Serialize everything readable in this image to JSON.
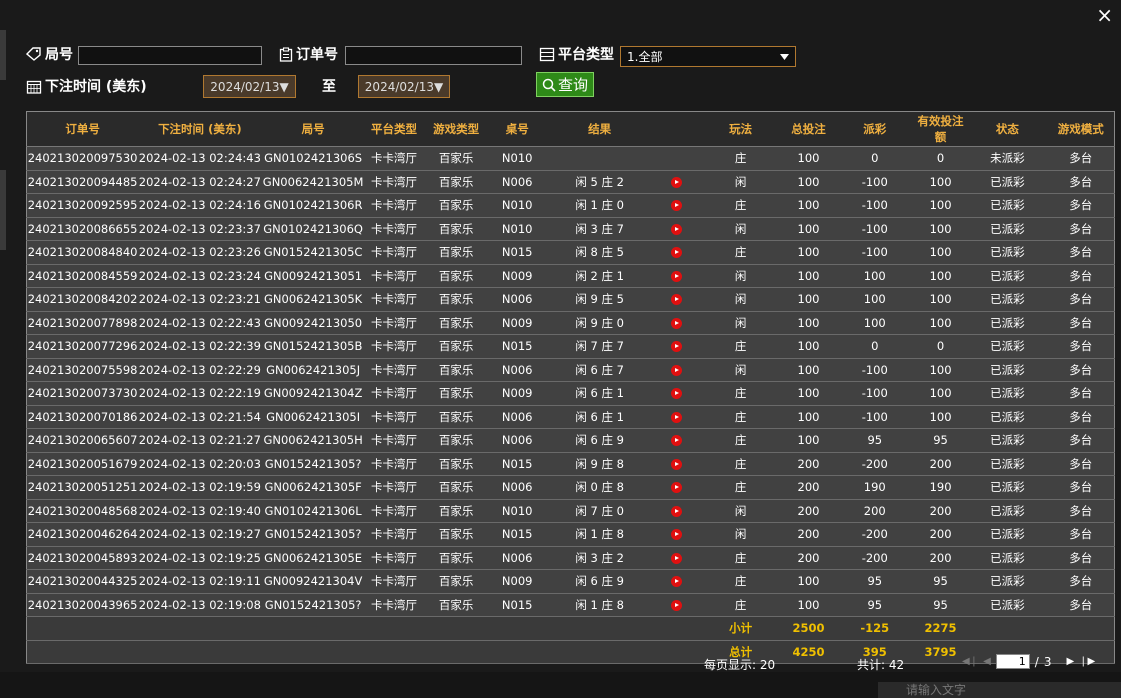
{
  "close_glyph": "×",
  "filters": {
    "round_label": "局号",
    "round_value": "",
    "order_label": "订单号",
    "order_value": "",
    "platform_label": "平台类型",
    "platform_value": "1.全部",
    "time_label": "下注时间 (美东)",
    "date_from": "2024/02/13▼",
    "to_label": "至",
    "date_to": "2024/02/13▼",
    "search_label": "查询"
  },
  "table": {
    "headers": [
      "订单号",
      "下注时间 (美东)",
      "局号",
      "平台类型",
      "游戏类型",
      "桌号",
      "结果",
      "",
      "玩法",
      "总投注",
      "派彩",
      "有效投注额",
      "状态",
      "游戏模式"
    ],
    "rows": [
      {
        "order": "240213020097530",
        "time": "2024-02-13 02:24:43",
        "round": "GN0102421306S",
        "platform": "卡卡湾厅",
        "game": "百家乐",
        "table": "N010",
        "result": "",
        "video": false,
        "bet": "庄",
        "total": "100",
        "payout": "0",
        "payout_type": "zero",
        "valid": "0",
        "status": "未派彩",
        "status_type": "none",
        "mode": "多台"
      },
      {
        "order": "240213020094485",
        "time": "2024-02-13 02:24:27",
        "round": "GN0062421305M",
        "platform": "卡卡湾厅",
        "game": "百家乐",
        "table": "N006",
        "result": "闲 5 庄 2",
        "video": true,
        "bet": "闲",
        "total": "100",
        "payout": "-100",
        "payout_type": "neg",
        "valid": "100",
        "status": "已派彩",
        "status_type": "done",
        "mode": "多台"
      },
      {
        "order": "240213020092595",
        "time": "2024-02-13 02:24:16",
        "round": "GN0102421306R",
        "platform": "卡卡湾厅",
        "game": "百家乐",
        "table": "N010",
        "result": "闲 1 庄 0",
        "video": true,
        "bet": "庄",
        "total": "100",
        "payout": "-100",
        "payout_type": "pos",
        "valid": "100",
        "status": "已派彩",
        "status_type": "done",
        "mode": "多台"
      },
      {
        "order": "240213020086655",
        "time": "2024-02-13 02:23:37",
        "round": "GN0102421306Q",
        "platform": "卡卡湾厅",
        "game": "百家乐",
        "table": "N010",
        "result": "闲 3 庄 7",
        "video": true,
        "bet": "闲",
        "total": "100",
        "payout": "-100",
        "payout_type": "pos",
        "valid": "100",
        "status": "已派彩",
        "status_type": "done",
        "mode": "多台"
      },
      {
        "order": "240213020084840",
        "time": "2024-02-13 02:23:26",
        "round": "GN0152421305C",
        "platform": "卡卡湾厅",
        "game": "百家乐",
        "table": "N015",
        "result": "闲 8 庄 5",
        "video": true,
        "bet": "庄",
        "total": "100",
        "payout": "-100",
        "payout_type": "pos",
        "valid": "100",
        "status": "已派彩",
        "status_type": "done",
        "mode": "多台"
      },
      {
        "order": "240213020084559",
        "time": "2024-02-13 02:23:24",
        "round": "GN00924213051",
        "platform": "卡卡湾厅",
        "game": "百家乐",
        "table": "N009",
        "result": "闲 2 庄 1",
        "video": true,
        "bet": "闲",
        "total": "100",
        "payout": "100",
        "payout_type": "neg",
        "valid": "100",
        "status": "已派彩",
        "status_type": "done",
        "mode": "多台"
      },
      {
        "order": "240213020084202",
        "time": "2024-02-13 02:23:21",
        "round": "GN0062421305K",
        "platform": "卡卡湾厅",
        "game": "百家乐",
        "table": "N006",
        "result": "闲 9 庄 5",
        "video": true,
        "bet": "闲",
        "total": "100",
        "payout": "100",
        "payout_type": "neg",
        "valid": "100",
        "status": "已派彩",
        "status_type": "done",
        "mode": "多台"
      },
      {
        "order": "240213020077898",
        "time": "2024-02-13 02:22:43",
        "round": "GN00924213050",
        "platform": "卡卡湾厅",
        "game": "百家乐",
        "table": "N009",
        "result": "闲 9 庄 0",
        "video": true,
        "bet": "闲",
        "total": "100",
        "payout": "100",
        "payout_type": "neg",
        "valid": "100",
        "status": "已派彩",
        "status_type": "done",
        "mode": "多台"
      },
      {
        "order": "240213020077296",
        "time": "2024-02-13 02:22:39",
        "round": "GN0152421305B",
        "platform": "卡卡湾厅",
        "game": "百家乐",
        "table": "N015",
        "result": "闲 7 庄 7",
        "video": true,
        "bet": "庄",
        "total": "100",
        "payout": "0",
        "payout_type": "zero",
        "valid": "0",
        "status": "已派彩",
        "status_type": "done",
        "mode": "多台"
      },
      {
        "order": "240213020075598",
        "time": "2024-02-13 02:22:29",
        "round": "GN0062421305J",
        "platform": "卡卡湾厅",
        "game": "百家乐",
        "table": "N006",
        "result": "闲 6 庄 7",
        "video": true,
        "bet": "闲",
        "total": "100",
        "payout": "-100",
        "payout_type": "pos",
        "valid": "100",
        "status": "已派彩",
        "status_type": "done",
        "mode": "多台"
      },
      {
        "order": "240213020073730",
        "time": "2024-02-13 02:22:19",
        "round": "GN0092421304Z",
        "platform": "卡卡湾厅",
        "game": "百家乐",
        "table": "N009",
        "result": "闲 6 庄 1",
        "video": true,
        "bet": "庄",
        "total": "100",
        "payout": "-100",
        "payout_type": "pos",
        "valid": "100",
        "status": "已派彩",
        "status_type": "done",
        "mode": "多台"
      },
      {
        "order": "240213020070186",
        "time": "2024-02-13 02:21:54",
        "round": "GN0062421305I",
        "platform": "卡卡湾厅",
        "game": "百家乐",
        "table": "N006",
        "result": "闲 6 庄 1",
        "video": true,
        "bet": "庄",
        "total": "100",
        "payout": "-100",
        "payout_type": "pos",
        "valid": "100",
        "status": "已派彩",
        "status_type": "done",
        "mode": "多台"
      },
      {
        "order": "240213020065607",
        "time": "2024-02-13 02:21:27",
        "round": "GN0062421305H",
        "platform": "卡卡湾厅",
        "game": "百家乐",
        "table": "N006",
        "result": "闲 6 庄 9",
        "video": true,
        "bet": "庄",
        "total": "100",
        "payout": "95",
        "payout_type": "neg",
        "valid": "95",
        "status": "已派彩",
        "status_type": "done",
        "mode": "多台"
      },
      {
        "order": "240213020051679",
        "time": "2024-02-13 02:20:03",
        "round": "GN0152421305?",
        "platform": "卡卡湾厅",
        "game": "百家乐",
        "table": "N015",
        "result": "闲 9 庄 8",
        "video": true,
        "bet": "庄",
        "total": "200",
        "payout": "-200",
        "payout_type": "pos",
        "valid": "200",
        "status": "已派彩",
        "status_type": "done",
        "mode": "多台"
      },
      {
        "order": "240213020051251",
        "time": "2024-02-13 02:19:59",
        "round": "GN0062421305F",
        "platform": "卡卡湾厅",
        "game": "百家乐",
        "table": "N006",
        "result": "闲 0 庄 8",
        "video": true,
        "bet": "庄",
        "total": "200",
        "payout": "190",
        "payout_type": "neg",
        "valid": "190",
        "status": "已派彩",
        "status_type": "done",
        "mode": "多台"
      },
      {
        "order": "240213020048568",
        "time": "2024-02-13 02:19:40",
        "round": "GN0102421306L",
        "platform": "卡卡湾厅",
        "game": "百家乐",
        "table": "N010",
        "result": "闲 7 庄 0",
        "video": true,
        "bet": "闲",
        "total": "200",
        "payout": "200",
        "payout_type": "neg",
        "valid": "200",
        "status": "已派彩",
        "status_type": "done",
        "mode": "多台"
      },
      {
        "order": "240213020046264",
        "time": "2024-02-13 02:19:27",
        "round": "GN0152421305?",
        "platform": "卡卡湾厅",
        "game": "百家乐",
        "table": "N015",
        "result": "闲 1 庄 8",
        "video": true,
        "bet": "闲",
        "total": "200",
        "payout": "-200",
        "payout_type": "pos",
        "valid": "200",
        "status": "已派彩",
        "status_type": "done",
        "mode": "多台"
      },
      {
        "order": "240213020045893",
        "time": "2024-02-13 02:19:25",
        "round": "GN0062421305E",
        "platform": "卡卡湾厅",
        "game": "百家乐",
        "table": "N006",
        "result": "闲 3 庄 2",
        "video": true,
        "bet": "庄",
        "total": "200",
        "payout": "-200",
        "payout_type": "pos",
        "valid": "200",
        "status": "已派彩",
        "status_type": "done",
        "mode": "多台"
      },
      {
        "order": "240213020044325",
        "time": "2024-02-13 02:19:11",
        "round": "GN0092421304V",
        "platform": "卡卡湾厅",
        "game": "百家乐",
        "table": "N009",
        "result": "闲 6 庄 9",
        "video": true,
        "bet": "庄",
        "total": "100",
        "payout": "95",
        "payout_type": "neg",
        "valid": "95",
        "status": "已派彩",
        "status_type": "done",
        "mode": "多台"
      },
      {
        "order": "240213020043965",
        "time": "2024-02-13 02:19:08",
        "round": "GN0152421305?",
        "platform": "卡卡湾厅",
        "game": "百家乐",
        "table": "N015",
        "result": "闲 1 庄 8",
        "video": true,
        "bet": "庄",
        "total": "100",
        "payout": "95",
        "payout_type": "neg",
        "valid": "95",
        "status": "已派彩",
        "status_type": "done",
        "mode": "多台"
      }
    ],
    "subtotal": {
      "label": "小计",
      "total": "2500",
      "payout": "-125",
      "valid": "2275"
    },
    "grandtotal": {
      "label": "总计",
      "total": "4250",
      "payout": "395",
      "valid": "3795"
    }
  },
  "footer": {
    "per_page": "每页显示: 20",
    "count": "共计: 42",
    "page_value": "1",
    "page_sep": "/",
    "page_total": "3"
  },
  "chat": {
    "placeholder": "请输入文字"
  },
  "colors": {
    "header_text": "#f0b040",
    "positive": "#3ad23a",
    "negative": "#d02020",
    "search_button": "#2e8a18"
  }
}
